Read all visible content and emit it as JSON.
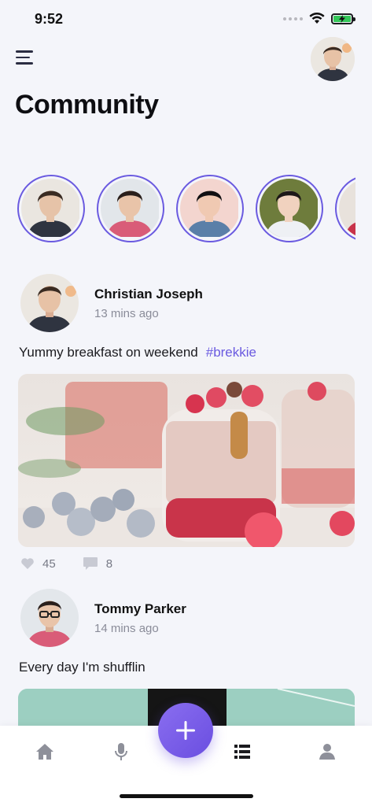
{
  "status_bar": {
    "time": "9:52"
  },
  "header": {
    "title": "Community"
  },
  "stories": [
    {
      "name": "story-1",
      "shirt": "#2f3440",
      "skin": "#e6c3a8",
      "hair": "#3a2b22",
      "bg": "#eae6e0"
    },
    {
      "name": "story-2",
      "shirt": "#d95c78",
      "skin": "#e9c4a9",
      "hair": "#2a1f1b",
      "bg": "#e2e6ea"
    },
    {
      "name": "story-3",
      "shirt": "#5a7fa8",
      "skin": "#f0c9b2",
      "hair": "#121012",
      "bg": "#f3d5cf"
    },
    {
      "name": "story-4",
      "shirt": "#eef0f4",
      "skin": "#f1d2bf",
      "hair": "#1d1818",
      "bg": "#6e7c3c"
    },
    {
      "name": "story-5",
      "shirt": "#c8334a",
      "skin": "#e8c0a5",
      "hair": "#1c1414",
      "bg": "#e8e2dc"
    }
  ],
  "posts": [
    {
      "author": "Christian Joseph",
      "time": "13 mins ago",
      "text": "Yummy breakfast on weekend",
      "hashtag": "#brekkie",
      "likes": "45",
      "comments": "8"
    },
    {
      "author": "Tommy Parker",
      "time": "14 mins ago",
      "text": "Every day I'm shufflin"
    }
  ],
  "tabbar": {
    "items": [
      "home-icon",
      "microphone-icon",
      "add-icon",
      "list-icon",
      "user-icon"
    ],
    "accent": "#6a5ae0"
  }
}
